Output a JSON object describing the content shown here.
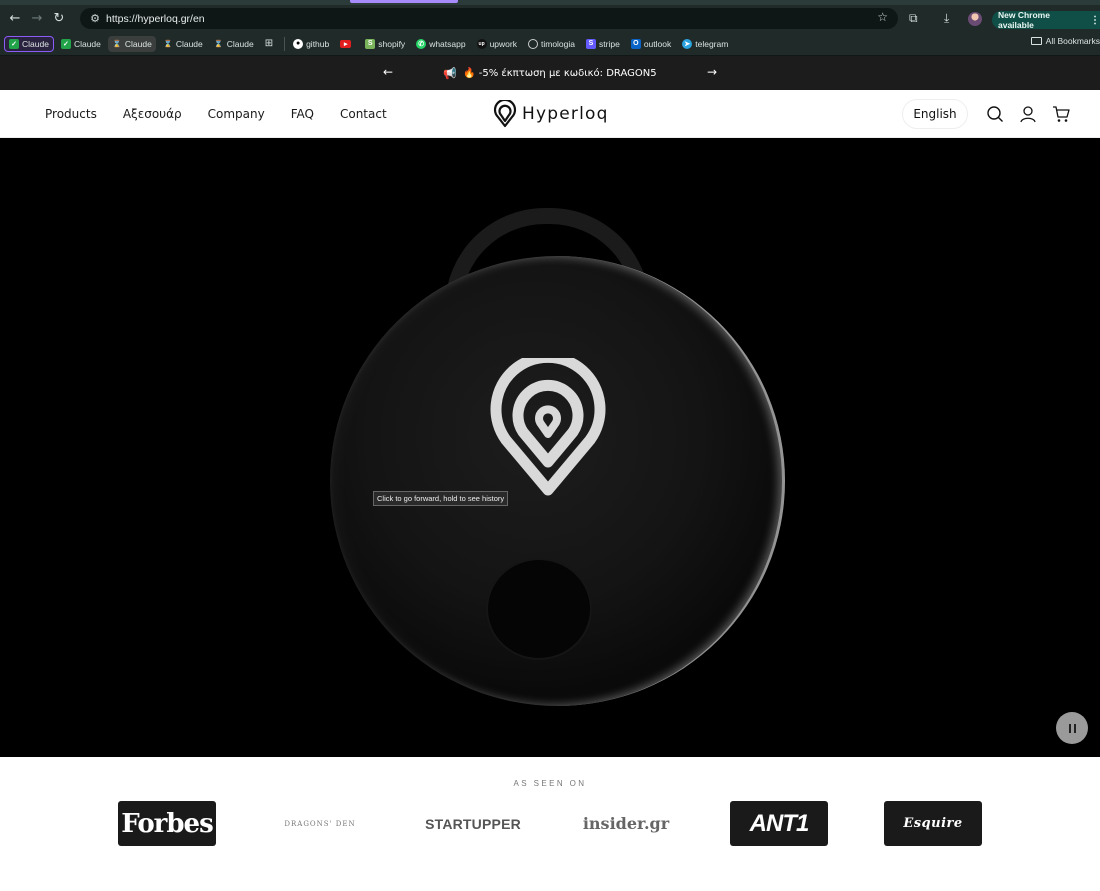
{
  "browser": {
    "url": "https://hyperloq.gr/en",
    "update_label": "New Chrome available",
    "all_bookmarks_label": "All Bookmarks",
    "bookmarks": [
      "Claude",
      "Claude",
      "Claude",
      "Claude",
      "Claude",
      "github",
      "shopify",
      "whatsapp",
      "upwork",
      "timologia",
      "stripe",
      "outlook",
      "telegram"
    ]
  },
  "announcement": {
    "text": "🔥 -5% έκπτωση με κωδικό: DRAGON5",
    "prev_arrow": "←",
    "next_arrow": "→"
  },
  "header": {
    "nav": [
      "Products",
      "Αξεσουάρ",
      "Company",
      "FAQ",
      "Contact"
    ],
    "brand": "Hyperloq",
    "language": "English"
  },
  "hero": {
    "tooltip": "Click to go forward, hold to see history"
  },
  "press": {
    "title": "AS SEEN ON",
    "logos": [
      "Forbes",
      "DRAGONS' DEN",
      "STARTUPPER",
      "insider.gr",
      "ANT1",
      "Esquire"
    ]
  }
}
